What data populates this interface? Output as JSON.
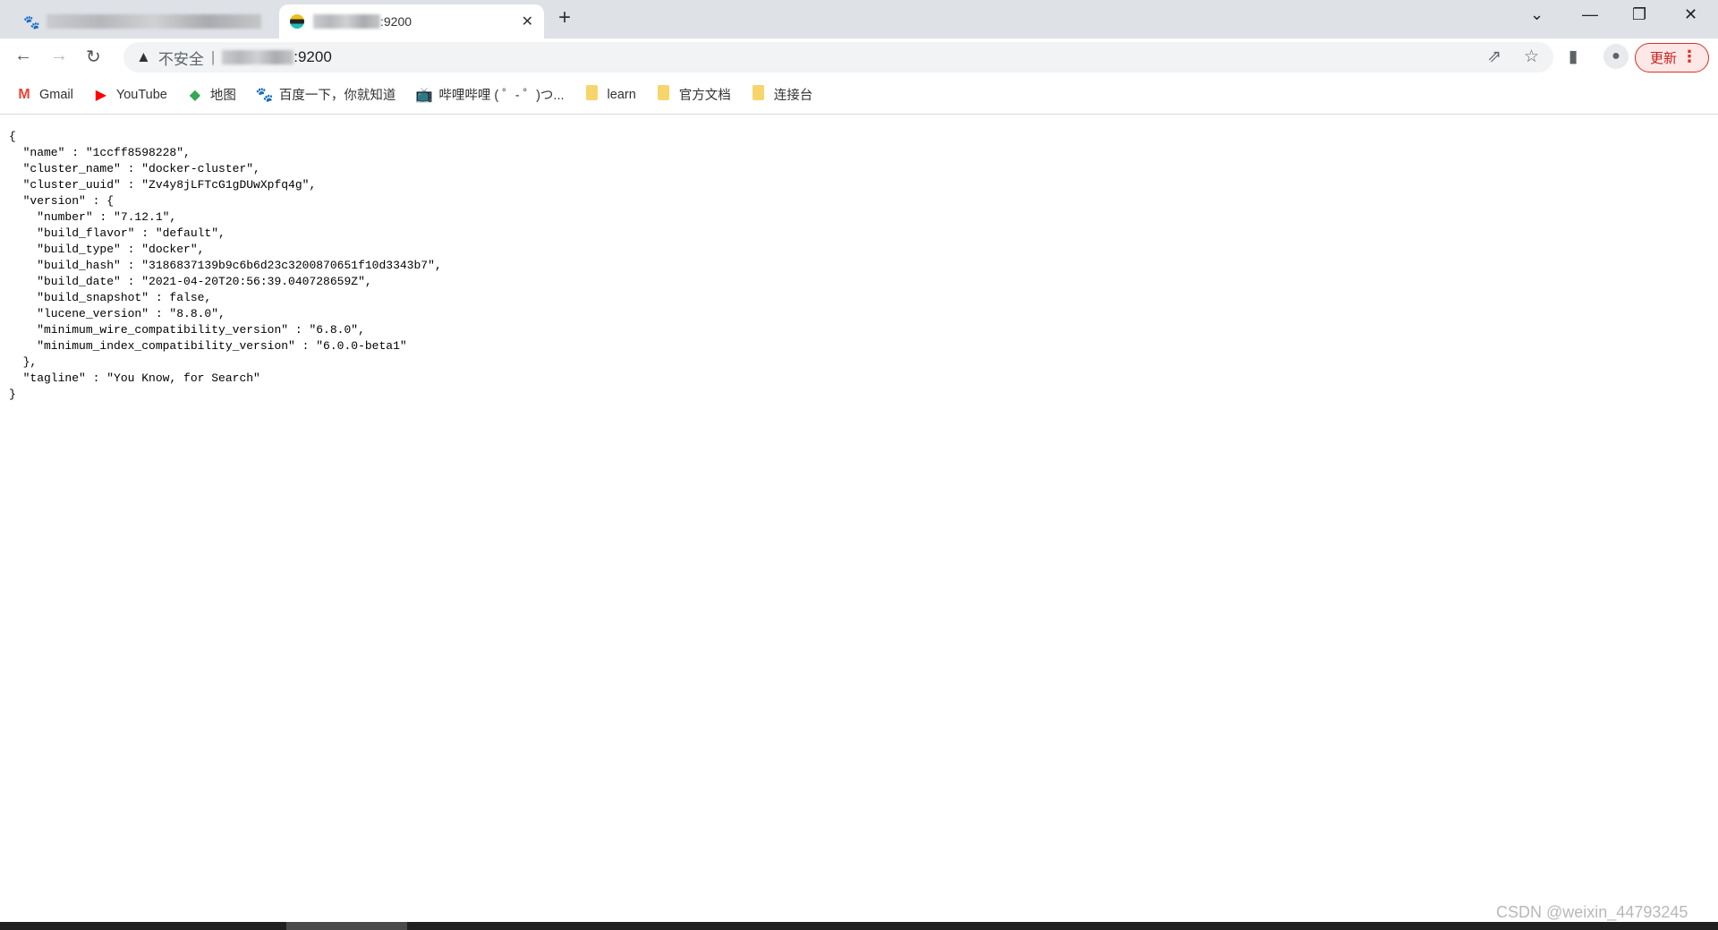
{
  "browser": {
    "tabs": [
      {
        "title": "",
        "icon": "baidu-paw-icon",
        "active": false
      },
      {
        "title": ":9200",
        "icon": "elastic-icon",
        "active": true
      }
    ],
    "address": {
      "security_label": "不安全",
      "url": ":9200"
    },
    "update_label": "更新",
    "bookmarks": [
      {
        "label": "Gmail",
        "icon": "gmail-icon"
      },
      {
        "label": "YouTube",
        "icon": "youtube-icon"
      },
      {
        "label": "地图",
        "icon": "maps-icon"
      },
      {
        "label": "百度一下，你就知道",
        "icon": "baidu-paw-icon"
      },
      {
        "label": "哔哩哔哩 ( ゜- ゜)つ...",
        "icon": "bilibili-icon"
      },
      {
        "label": "learn",
        "icon": "folder-icon"
      },
      {
        "label": "官方文档",
        "icon": "folder-icon"
      },
      {
        "label": "连接台",
        "icon": "folder-icon"
      }
    ]
  },
  "content": {
    "json_text": "{\n  \"name\" : \"1ccff8598228\",\n  \"cluster_name\" : \"docker-cluster\",\n  \"cluster_uuid\" : \"Zv4y8jLFTcG1gDUwXpfq4g\",\n  \"version\" : {\n    \"number\" : \"7.12.1\",\n    \"build_flavor\" : \"default\",\n    \"build_type\" : \"docker\",\n    \"build_hash\" : \"3186837139b9c6b6d23c3200870651f10d3343b7\",\n    \"build_date\" : \"2021-04-20T20:56:39.040728659Z\",\n    \"build_snapshot\" : false,\n    \"lucene_version\" : \"8.8.0\",\n    \"minimum_wire_compatibility_version\" : \"6.8.0\",\n    \"minimum_index_compatibility_version\" : \"6.0.0-beta1\"\n  },\n  \"tagline\" : \"You Know, for Search\"\n}"
  },
  "watermark": "CSDN @weixin_44793245",
  "colors": {
    "tabbar": "#dee1e6",
    "update_accent": "#d93025"
  }
}
